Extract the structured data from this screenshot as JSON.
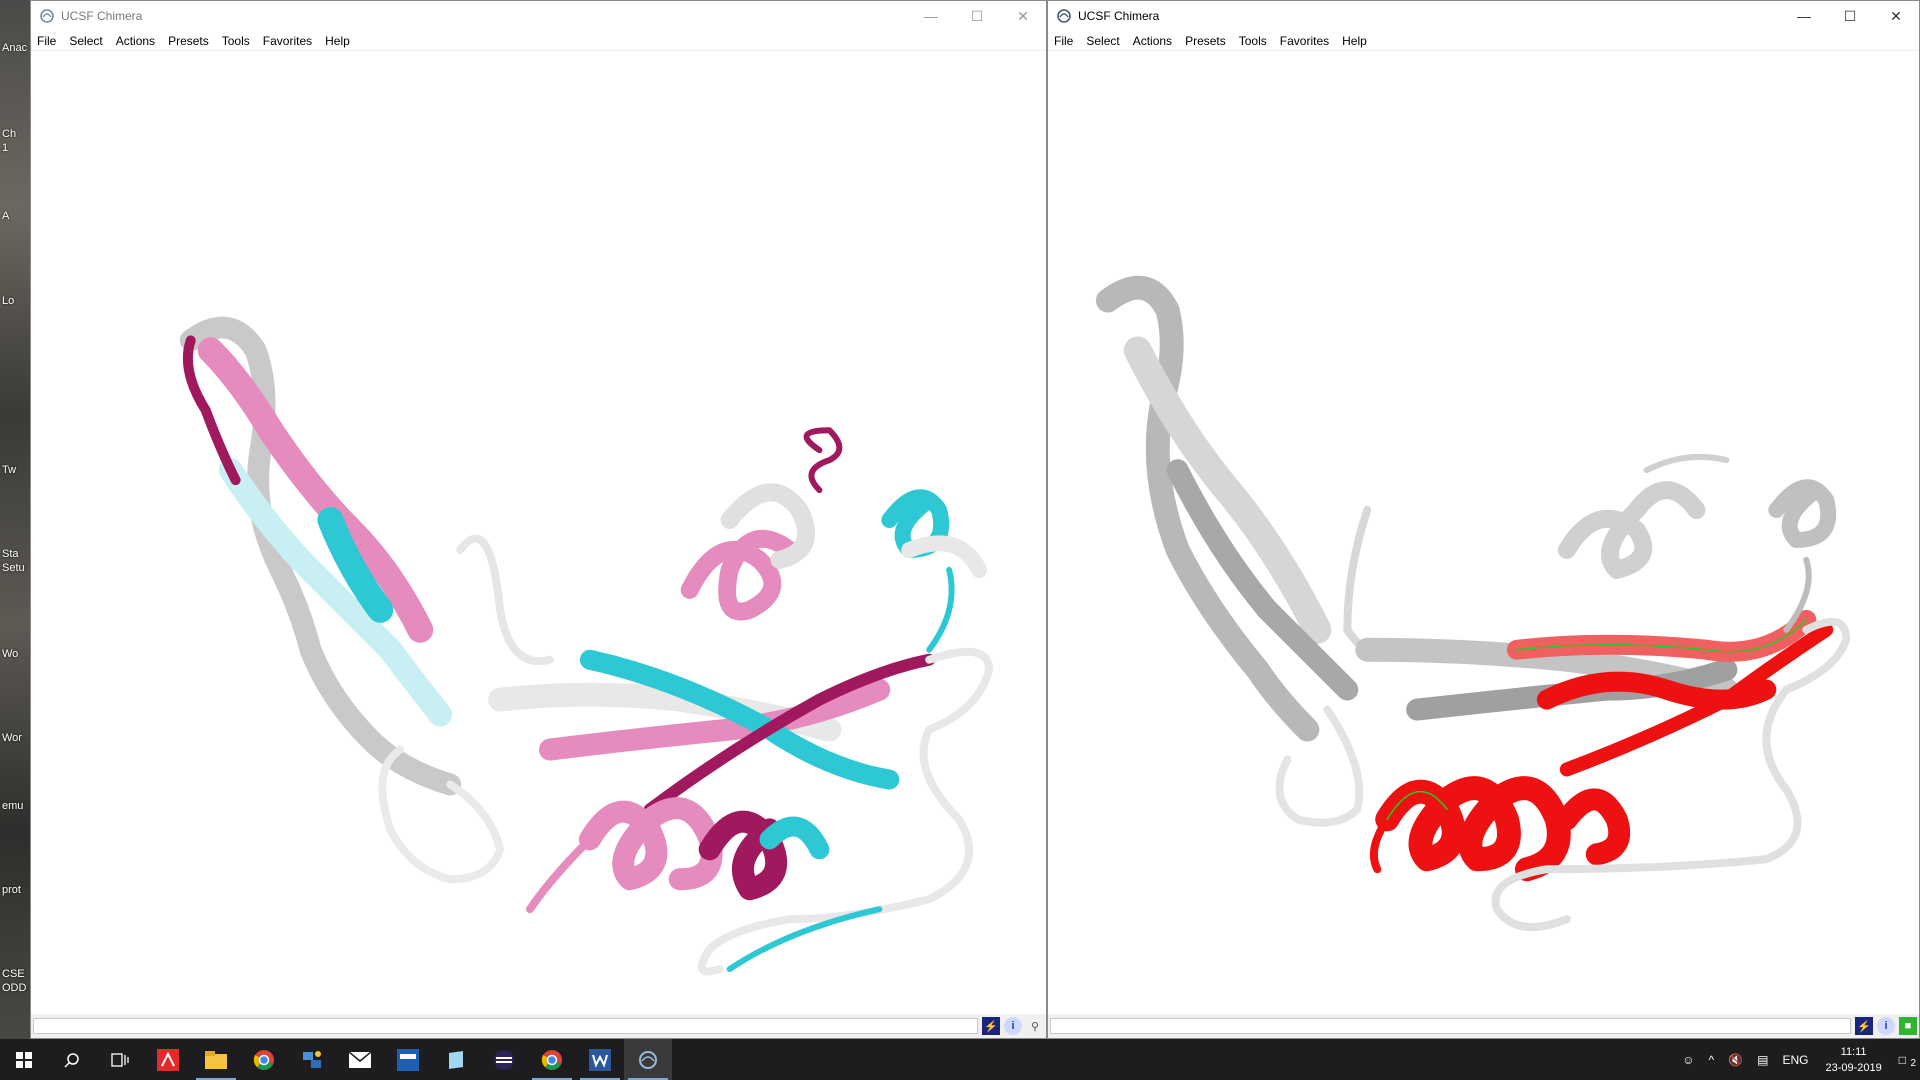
{
  "desktop": {
    "labels": [
      "Anac",
      "Ch",
      "1",
      "A",
      "Lo",
      "Tw",
      "Sta",
      "Setu",
      "Wo",
      "Wor",
      "emu",
      "prot",
      "CSE",
      "ODD"
    ]
  },
  "left_window": {
    "title": "UCSF Chimera",
    "menu": [
      "File",
      "Select",
      "Actions",
      "Presets",
      "Tools",
      "Favorites",
      "Help"
    ]
  },
  "right_window": {
    "title": "UCSF Chimera",
    "menu": [
      "File",
      "Select",
      "Actions",
      "Presets",
      "Tools",
      "Favorites",
      "Help"
    ]
  },
  "colors": {
    "cyan": "#2ec8d4",
    "pink": "#e58bbd",
    "magenta": "#a0185e",
    "white_ribbon": "#e8e8e8",
    "red": "#ee1111",
    "green_outline": "#22cc22"
  },
  "taskbar": {
    "apps": [
      "windows-start",
      "search",
      "task-view",
      "acrobat",
      "file-explorer",
      "chrome",
      "network-app",
      "mail",
      "dev-app",
      "notes-app",
      "eclipse",
      "chrome-2",
      "word",
      "chimera"
    ],
    "tray": {
      "language": "ENG",
      "time": "11:11",
      "date": "23-09-2019",
      "notifications": "2"
    }
  }
}
